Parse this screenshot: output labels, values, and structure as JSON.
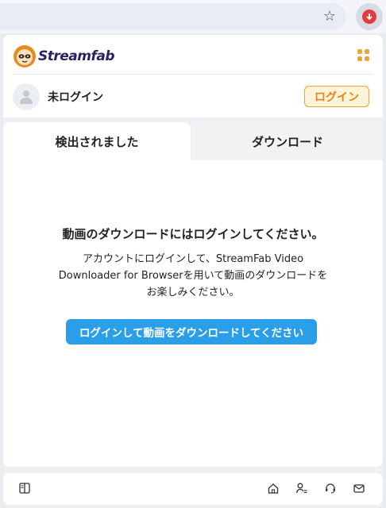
{
  "browser": {
    "star_icon": "star-icon",
    "extension_icon": "streamfab-download-icon",
    "extension_color": "#e23b3b"
  },
  "header": {
    "logo_text": "Streamfab",
    "menu_icon": "grid-icon",
    "user_status": "未ログイン",
    "login_button": "ログイン"
  },
  "tabs": [
    {
      "label": "検出されました",
      "active": true
    },
    {
      "label": "ダウンロード",
      "active": false
    }
  ],
  "main": {
    "title": "動画のダウンロードにはログインしてください。",
    "body_line1": "アカウントにログインして、StreamFab Video",
    "body_line2": "Downloader for Browserを用いて動画のダウンロードを",
    "body_line3": "お楽しみください。",
    "cta_button": "ログインして動画をダウンロードしてください"
  },
  "footer": {
    "icons": [
      "sidebar-panel-icon",
      "home-icon",
      "user-list-icon",
      "support-headset-icon",
      "mail-icon"
    ]
  },
  "colors": {
    "accent_orange": "#f0a437",
    "cta_blue": "#2a9ee9",
    "brand_navy": "#2b2160"
  }
}
